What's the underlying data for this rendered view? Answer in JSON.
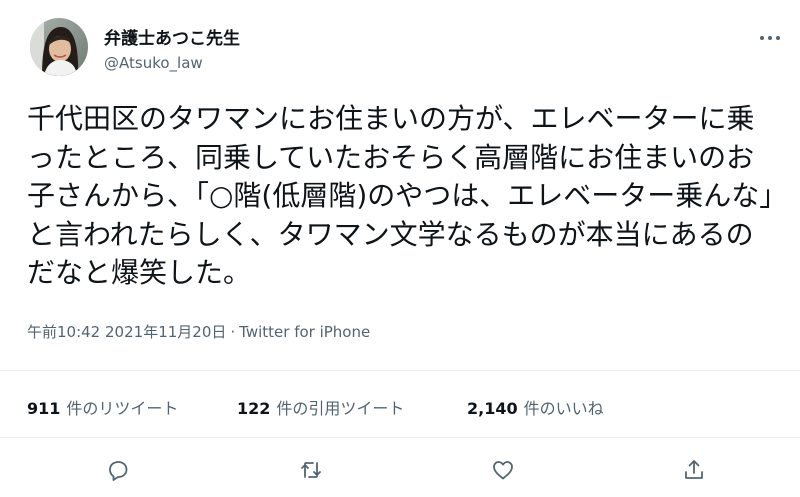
{
  "author": {
    "display_name": "弁護士あつこ先生",
    "handle": "@Atsuko_law"
  },
  "tweet": {
    "text": "千代田区のタワマンにお住まいの方が、エレベーターに乗ったところ、同乗していたおそらく高層階にお住まいのお子さんから、「○階(低層階)のやつは、エレベーター乗んな」と言われたらしく、タワマン文学なるものが本当にあるのだなと爆笑した。",
    "time": "午前10:42",
    "date": "2021年11月20日",
    "source": "Twitter for iPhone",
    "separator": "·"
  },
  "stats": {
    "retweets": {
      "count": "911",
      "label": "件のリツイート"
    },
    "quotes": {
      "count": "122",
      "label": "件の引用ツイート"
    },
    "likes": {
      "count": "2,140",
      "label": "件のいいね"
    }
  },
  "icons": {
    "more": "more-horizontal-icon",
    "reply": "reply-icon",
    "retweet": "retweet-icon",
    "like": "like-icon",
    "share": "share-icon"
  },
  "colors": {
    "text": "#0f1419",
    "secondary": "#536471",
    "divider": "#e6ecf0"
  }
}
